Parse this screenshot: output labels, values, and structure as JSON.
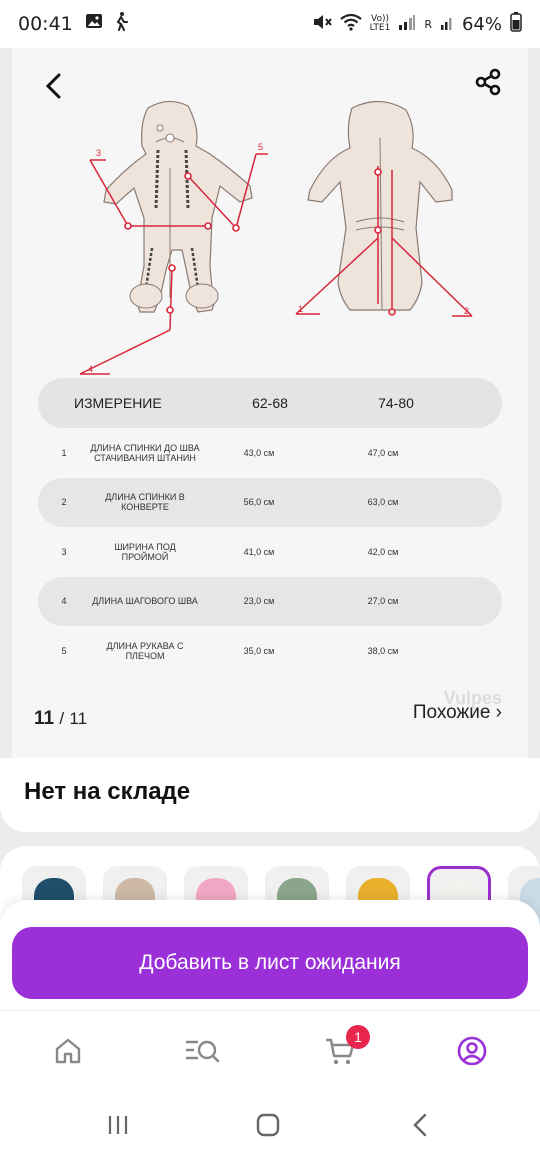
{
  "status_bar": {
    "time": "00:41",
    "network_top": "Vo))",
    "network_bottom": "LTE1",
    "roaming": "R",
    "battery": "64%"
  },
  "gallery": {
    "counter_current": "11",
    "counter_separator": "/",
    "counter_total": "11",
    "watermark": "Vulpes",
    "similar_link": "Похожие ›",
    "diagram_markers": [
      "3",
      "5",
      "4",
      "1",
      "2"
    ]
  },
  "size_table": {
    "headers": [
      "ИЗМЕРЕНИЕ",
      "62-68",
      "74-80"
    ],
    "rows": [
      {
        "num": "1",
        "label": "ДЛИНА СПИНКИ ДО ШВА СТАЧИВАНИЯ ШТАНИН",
        "v1": "43,0 см",
        "v2": "47,0 см"
      },
      {
        "num": "2",
        "label": "ДЛИНА СПИНКИ В КОНВЕРТЕ",
        "v1": "56,0 см",
        "v2": "63,0 см"
      },
      {
        "num": "3",
        "label": "ШИРИНА ПОД ПРОЙМОЙ",
        "v1": "41,0 см",
        "v2": "42,0 см"
      },
      {
        "num": "4",
        "label": "ДЛИНА ШАГОВОГО ШВА",
        "v1": "23,0 см",
        "v2": "27,0 см"
      },
      {
        "num": "5",
        "label": "ДЛИНА РУКАВА С ПЛЕЧОМ",
        "v1": "35,0 см",
        "v2": "38,0 см"
      }
    ]
  },
  "stock": {
    "title": "Нет на складе"
  },
  "colors": [
    {
      "name": "navy",
      "hex": "#1f4e6b"
    },
    {
      "name": "beige",
      "hex": "#cdb9a6"
    },
    {
      "name": "pink",
      "hex": "#f1a6c4"
    },
    {
      "name": "olive",
      "hex": "#8ba58a"
    },
    {
      "name": "yellow",
      "hex": "#eab02c"
    },
    {
      "name": "white",
      "hex": "#f4f2ee"
    },
    {
      "name": "light-blue",
      "hex": "#c9dbe6"
    }
  ],
  "cta": {
    "label": "Добавить в лист ожидания"
  },
  "tabbar": {
    "cart_badge": "1"
  },
  "theme": {
    "accent": "#9b30d9",
    "badge": "#e8264d",
    "marker": "#d8263a"
  }
}
